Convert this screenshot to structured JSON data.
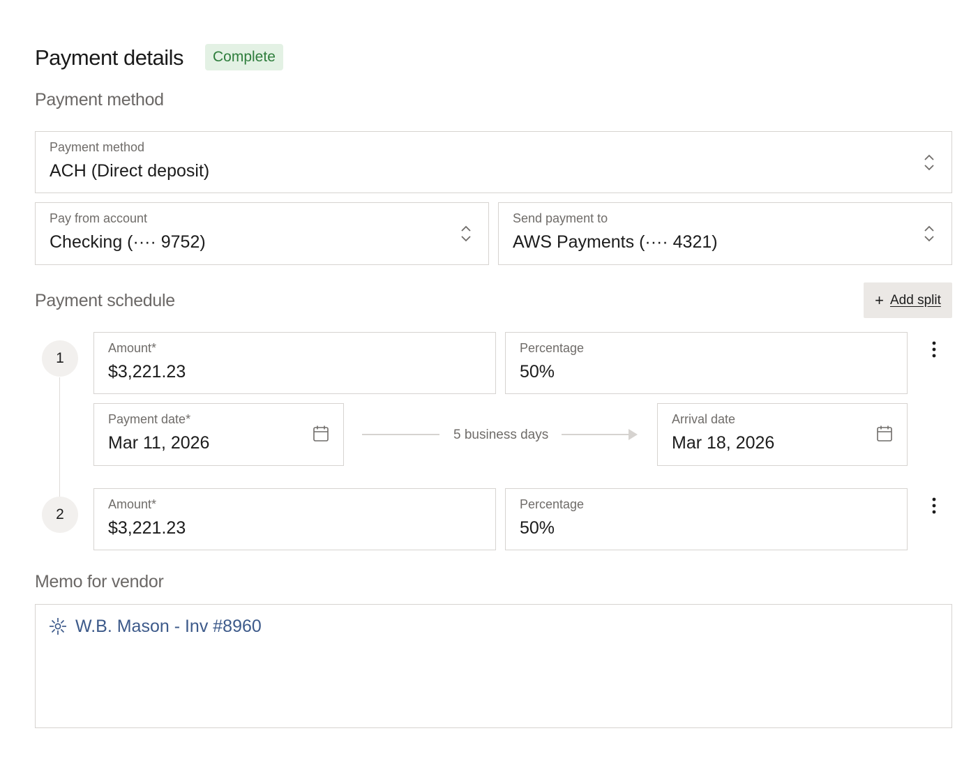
{
  "header": {
    "title": "Payment details",
    "status_badge": "Complete"
  },
  "payment_method_section": {
    "title": "Payment method",
    "payment_method": {
      "label": "Payment method",
      "value": "ACH (Direct deposit)"
    },
    "pay_from": {
      "label": "Pay from account",
      "value": "Checking (···· 9752)"
    },
    "send_to": {
      "label": "Send payment to",
      "value": "AWS Payments (···· 4321)"
    }
  },
  "schedule": {
    "title": "Payment schedule",
    "add_split_label": "Add split",
    "splits": [
      {
        "number": "1",
        "amount": {
          "label": "Amount*",
          "value": "$3,221.23"
        },
        "percentage": {
          "label": "Percentage",
          "value": "50%"
        },
        "payment_date": {
          "label": "Payment date*",
          "value": "Mar 11, 2026"
        },
        "transit": "5 business days",
        "arrival_date": {
          "label": "Arrival date",
          "value": "Mar 18, 2026"
        }
      },
      {
        "number": "2",
        "amount": {
          "label": "Amount*",
          "value": "$3,221.23"
        },
        "percentage": {
          "label": "Percentage",
          "value": "50%"
        }
      }
    ]
  },
  "memo": {
    "title": "Memo for vendor",
    "text": "W.B. Mason - Inv #8960",
    "icon": "sparkle-icon"
  },
  "colors": {
    "badge_bg": "#e3f1e4",
    "badge_text": "#2e7d3c",
    "memo_text": "#3d5a8a",
    "border": "#d6d3d0"
  }
}
